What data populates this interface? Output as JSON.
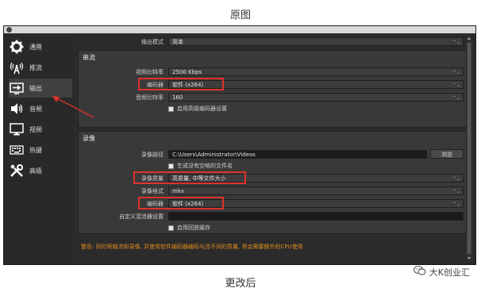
{
  "captions": {
    "top": "原图",
    "bottom": "更改后"
  },
  "sidebar": {
    "items": [
      {
        "label": "通用",
        "icon": "gear-icon"
      },
      {
        "label": "推流",
        "icon": "broadcast-icon"
      },
      {
        "label": "输出",
        "icon": "output-icon"
      },
      {
        "label": "音频",
        "icon": "speaker-icon"
      },
      {
        "label": "视频",
        "icon": "monitor-icon"
      },
      {
        "label": "热键",
        "icon": "keyboard-icon"
      },
      {
        "label": "高级",
        "icon": "tools-icon"
      }
    ]
  },
  "output": {
    "mode_label": "输出模式",
    "mode_value": "简单"
  },
  "streaming": {
    "section": "串流",
    "video_bitrate_label": "视频比特率",
    "video_bitrate_value": "2500 Kbps",
    "encoder_label": "编码器",
    "encoder_value": "软件 (x264)",
    "audio_bitrate_label": "音频比特率",
    "audio_bitrate_value": "160",
    "advanced_encoder_checkbox": "启用高级编码器设置"
  },
  "recording": {
    "section": "录像",
    "path_label": "录像路径",
    "path_value": "C:\\Users\\Administrator\\Videos",
    "browse_button": "浏览",
    "no_space_checkbox": "生成没有空格的文件名",
    "quality_label": "录像质量",
    "quality_value": "高质量, 中等文件大小",
    "format_label": "录像格式",
    "format_value": "mkv",
    "encoder_label": "编码器",
    "encoder_value": "软件 (x264)",
    "muxer_label": "自定义混流器设置",
    "muxer_value": "",
    "replay_checkbox": "启用回放缓存"
  },
  "warning": "警告: 同时将输流和录像, 并使用软件编码器编码与流不同的质量, 将会需要额外的CPU使用",
  "watermark": {
    "icon": "wechat-icon",
    "text": "大K创业汇"
  },
  "colors": {
    "highlight": "#e0322c",
    "warning": "#e08a1e",
    "background": "#2b2b2b"
  }
}
